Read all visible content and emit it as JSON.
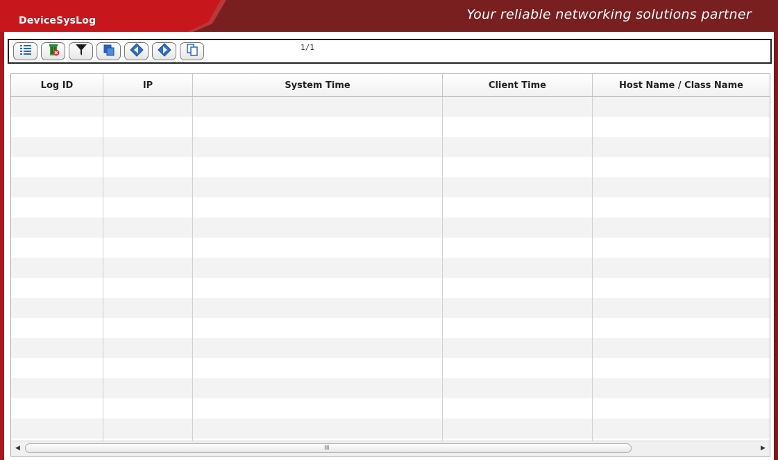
{
  "header": {
    "app_title": "DeviceSysLog",
    "slogan": "Your reliable networking solutions partner",
    "brand_red": "#c8161d",
    "brand_dark": "#7a1f1f"
  },
  "toolbar": {
    "buttons": [
      {
        "icon": "list-icon"
      },
      {
        "icon": "delete-icon"
      },
      {
        "icon": "filter-icon"
      },
      {
        "icon": "copy-icon"
      },
      {
        "icon": "previous-icon"
      },
      {
        "icon": "next-icon"
      },
      {
        "icon": "pages-icon"
      }
    ],
    "page_indicator": "1/1"
  },
  "grid": {
    "columns": [
      "Log ID",
      "IP",
      "System Time",
      "Client Time",
      "Host Name / Class Name"
    ],
    "row_count": 17,
    "scrollbar_grip": "IIII"
  }
}
